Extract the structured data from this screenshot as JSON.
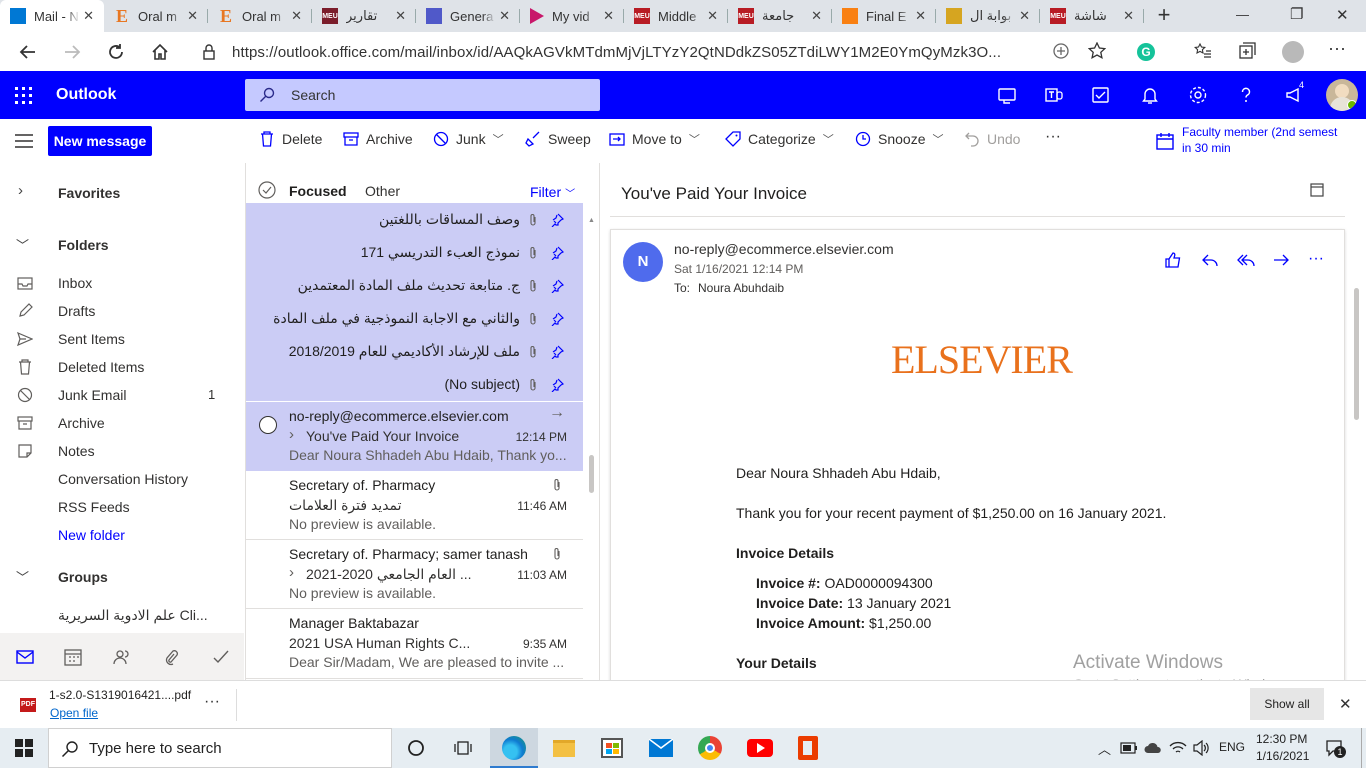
{
  "browser": {
    "tabs": [
      {
        "title": "Mail - N",
        "icon": "outlook-icon",
        "color": "#0078d4",
        "active": true
      },
      {
        "title": "Oral m",
        "icon": "e-letter-icon",
        "color": "#e87722",
        "active": false
      },
      {
        "title": "Oral m",
        "icon": "e-letter-icon",
        "color": "#e87722",
        "active": false
      },
      {
        "title": "تقارير",
        "icon": "meu-icon",
        "color": "#7b1d2b",
        "active": false
      },
      {
        "title": "Genera",
        "icon": "teams-icon",
        "color": "#5059c9",
        "active": false
      },
      {
        "title": "My vid",
        "icon": "play-icon",
        "color": "#c8176a",
        "active": false
      },
      {
        "title": "Middle",
        "icon": "meu-icon",
        "color": "#b81c24",
        "active": false
      },
      {
        "title": "جامعة",
        "icon": "meu-icon",
        "color": "#b81c24",
        "active": false
      },
      {
        "title": "Final E",
        "icon": "moodle-icon",
        "color": "#f98012",
        "active": false
      },
      {
        "title": "بوابة ال",
        "icon": "portal-icon",
        "color": "#d6a520",
        "active": false
      },
      {
        "title": "شاشة",
        "icon": "meu-icon",
        "color": "#b81c24",
        "active": false
      }
    ],
    "new_tab": "+",
    "url": "https://outlook.office.com/mail/inbox/id/AAQkAGVkMTdmMjVjLTYzY2QtNDdkZS05ZTdiLWY1M2E0YmQyMzk3O...",
    "window_controls": {
      "minimize": "—",
      "restore": "❐",
      "close": "✕"
    }
  },
  "outlook": {
    "app_name": "Outlook",
    "search_placeholder": "Search",
    "notification_count": "4",
    "accent": "#0000ff"
  },
  "command_bar": {
    "new_message": "New message",
    "delete": "Delete",
    "archive": "Archive",
    "junk": "Junk",
    "sweep": "Sweep",
    "move_to": "Move to",
    "categorize": "Categorize",
    "snooze": "Snooze",
    "undo": "Undo",
    "more": "···",
    "reminder_title": "Faculty member (2nd semest",
    "reminder_time": "in 30 min"
  },
  "nav": {
    "favorites": "Favorites",
    "folders": "Folders",
    "items": [
      {
        "label": "Inbox",
        "icon": "inbox-icon",
        "count": ""
      },
      {
        "label": "Drafts",
        "icon": "pencil-icon",
        "count": ""
      },
      {
        "label": "Sent Items",
        "icon": "send-icon",
        "count": ""
      },
      {
        "label": "Deleted Items",
        "icon": "trash-icon",
        "count": ""
      },
      {
        "label": "Junk Email",
        "icon": "block-icon",
        "count": "1"
      },
      {
        "label": "Archive",
        "icon": "archive-icon",
        "count": ""
      },
      {
        "label": "Notes",
        "icon": "note-icon",
        "count": ""
      },
      {
        "label": "Conversation History",
        "icon": "",
        "count": ""
      },
      {
        "label": "RSS Feeds",
        "icon": "",
        "count": ""
      }
    ],
    "new_folder": "New folder",
    "groups": "Groups",
    "group_item": "علم الادوية السريرية Cli..."
  },
  "list": {
    "tab_focused": "Focused",
    "tab_other": "Other",
    "filter": "Filter",
    "pinned": [
      {
        "subject": "وصف المساقات باللغتين"
      },
      {
        "subject": "نموذج العبء التدريسي 171"
      },
      {
        "subject": "ج. متابعة تحديث ملف المادة المعتمدين"
      },
      {
        "subject": "والثاني مع الاجابة النموذجية في ملف المادة"
      },
      {
        "subject": "ملف للإرشاد الأكاديمي للعام 2018/2019"
      },
      {
        "subject": "(No subject)"
      }
    ],
    "messages": [
      {
        "sender": "no-reply@ecommerce.elsevier.com",
        "subject": "You've Paid Your Invoice",
        "time": "12:14 PM",
        "preview": "Dear Noura Shhadeh Abu Hdaib, Thank yo...",
        "selected": true,
        "expander": true
      },
      {
        "sender": "Secretary of. Pharmacy",
        "subject": "تمديد فترة العلامات",
        "time": "11:46 AM",
        "preview": "No preview is available.",
        "selected": false,
        "expander": false
      },
      {
        "sender": "Secretary of. Pharmacy; samer tanash",
        "subject": "العام الجامعي 2020-2021 ...",
        "time": "11:03 AM",
        "preview": "No preview is available.",
        "selected": false,
        "expander": true
      },
      {
        "sender": "Manager Baktabazar",
        "subject": "2021 USA Human Rights C...",
        "time": "9:35 AM",
        "preview": "Dear Sir/Madam, We are pleased to invite ...",
        "selected": false,
        "expander": false
      }
    ]
  },
  "reading": {
    "subject": "You've Paid Your Invoice",
    "avatar_letter": "N",
    "avatar_color": "#4f6bed",
    "from": "no-reply@ecommerce.elsevier.com",
    "date": "Sat 1/16/2021 12:14 PM",
    "to_label": "To:",
    "to": "Noura Abuhdaib",
    "logo": "ELSEVIER",
    "logo_color": "#e9711c",
    "greeting": "Dear Noura Shhadeh Abu Hdaib,",
    "thanks": "Thank you for your recent payment of $1,250.00 on 16 January 2021.",
    "invoice_heading": "Invoice Details",
    "invoice_no_label": "Invoice #:",
    "invoice_no": "OAD0000094300",
    "invoice_date_label": "Invoice Date:",
    "invoice_date": "13 January 2021",
    "invoice_amount_label": "Invoice Amount:",
    "invoice_amount": "$1,250.00",
    "your_details": "Your Details"
  },
  "watermark": {
    "line1": "Activate Windows",
    "line2": "Go to Settings to activate Windows."
  },
  "download": {
    "file_name": "1-s2.0-S1319016421....pdf",
    "open_file": "Open file",
    "show_all": "Show all"
  },
  "taskbar": {
    "search_placeholder": "Type here to search",
    "language": "ENG",
    "time": "12:30 PM",
    "date": "1/16/2021",
    "notifications": "1"
  }
}
